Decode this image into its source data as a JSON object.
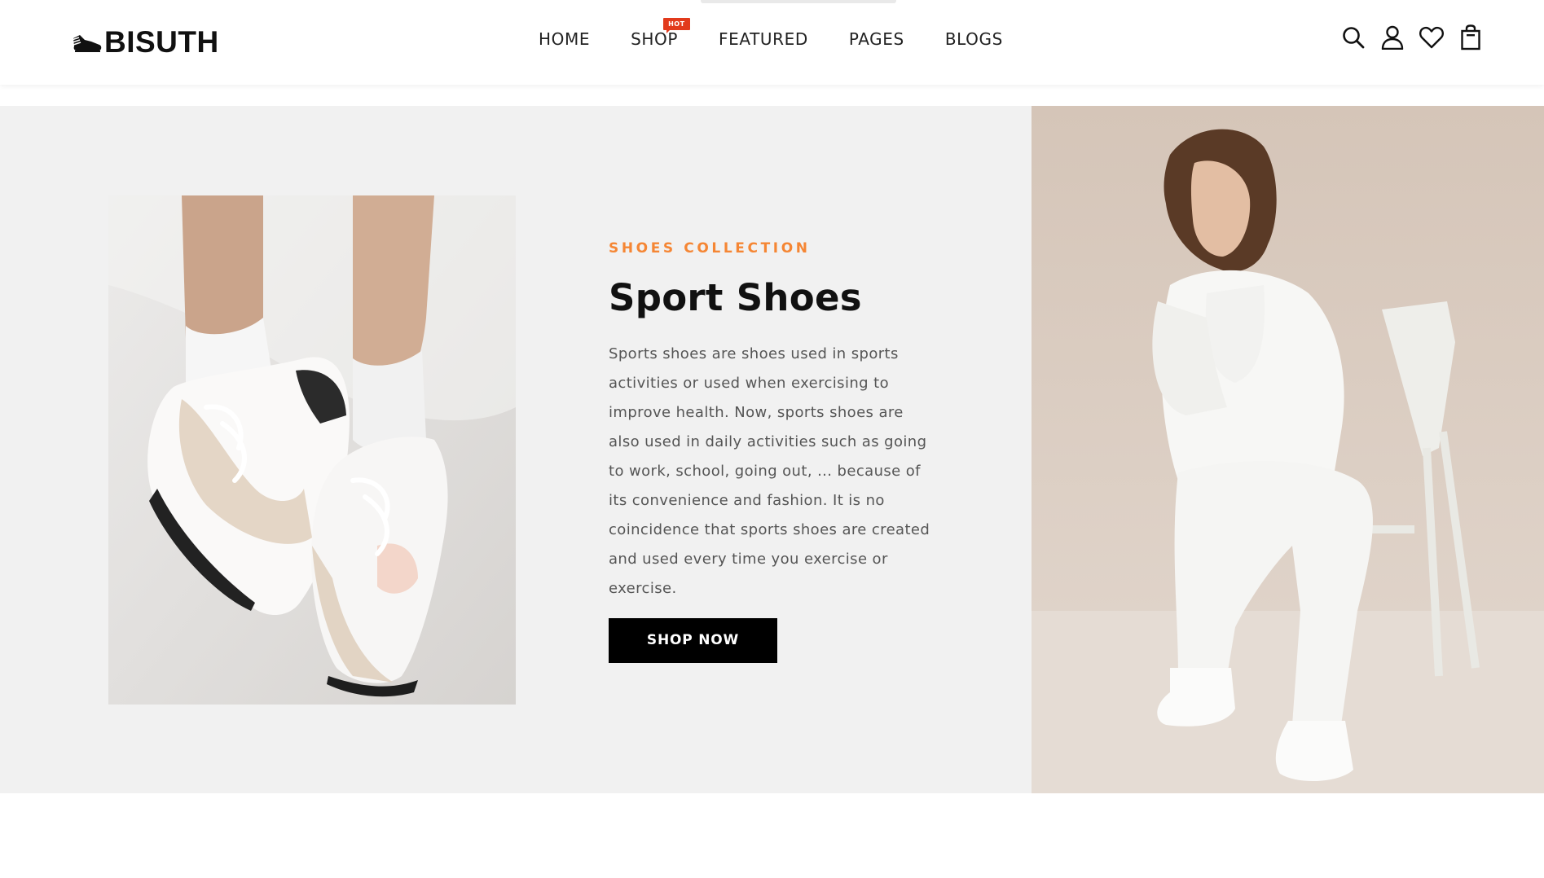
{
  "brand": {
    "name": "BISUTH",
    "logo_icon": "sneaker-icon"
  },
  "nav": {
    "items": [
      {
        "label": "HOME"
      },
      {
        "label": "SHOP",
        "badge": "HOT"
      },
      {
        "label": "FEATURED"
      },
      {
        "label": "PAGES"
      },
      {
        "label": "BLOGS"
      }
    ]
  },
  "header_icons": [
    "search-icon",
    "user-icon",
    "heart-icon",
    "shopping-bag-icon"
  ],
  "hero": {
    "eyebrow": "SHOES COLLECTION",
    "title": "Sport Shoes",
    "description": "Sports shoes are shoes used in sports activities or used when exercising to improve health. Now, sports shoes are also used in daily activities such as going to work, school, going out, ... because of its convenience and fashion. It is no coincidence that sports shoes are created and used every time you exercise or exercise.",
    "cta_label": "SHOP NOW"
  },
  "colors": {
    "accent": "#f58634",
    "badge": "#e23a1c",
    "hero_bg": "#f1f1f1",
    "button_bg": "#000000"
  }
}
